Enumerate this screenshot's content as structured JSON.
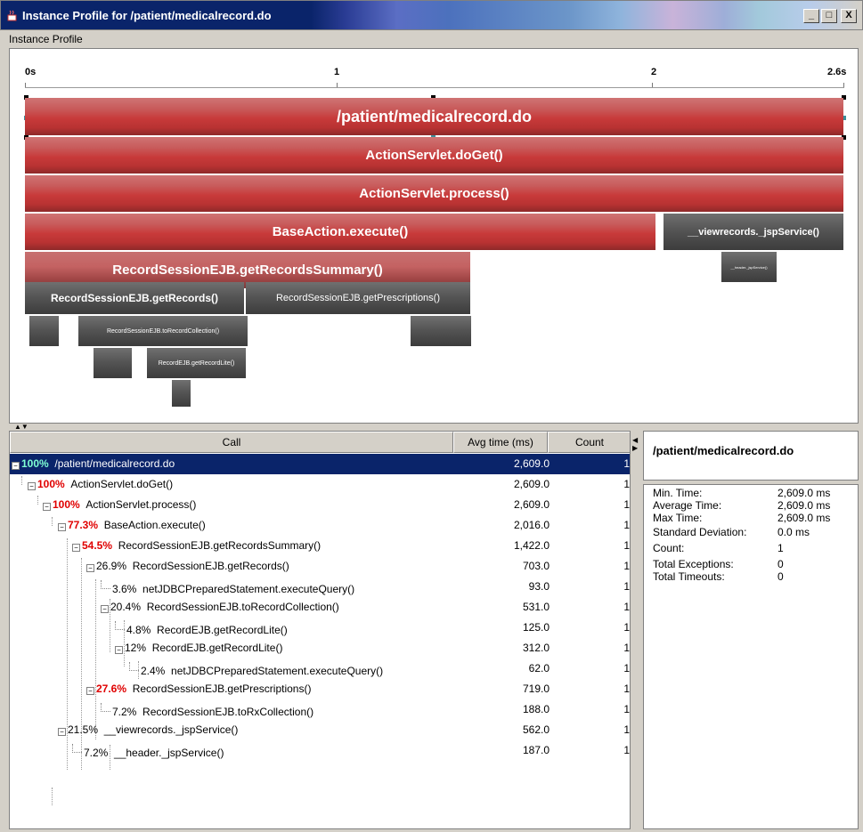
{
  "window": {
    "title": "Instance  Profile for /patient/medicalrecord.do",
    "buttons": [
      "_",
      "□",
      "X"
    ]
  },
  "panel_label": "Instance Profile",
  "timeline": {
    "ticks": [
      "0s",
      "1",
      "2",
      "2.6s"
    ]
  },
  "flame_bars": [
    {
      "label": "/patient/medicalrecord.do"
    },
    {
      "label": "ActionServlet.doGet()"
    },
    {
      "label": "ActionServlet.process()"
    },
    {
      "label": "BaseAction.execute()"
    },
    {
      "label": "__viewrecords._jspService()"
    },
    {
      "label": "__header._jspService()"
    },
    {
      "label": "RecordSessionEJB.getRecordsSummary()"
    },
    {
      "label": "RecordSessionEJB.getRecords()"
    },
    {
      "label": "RecordSessionEJB.getPrescriptions()"
    },
    {
      "label": "RecordSessionEJB.toRecordCollection()"
    },
    {
      "label": "RecordEJB.getRecordLite()"
    }
  ],
  "table": {
    "headers": {
      "call": "Call",
      "avg": "Avg time (ms)",
      "count": "Count"
    },
    "rows": [
      {
        "pct": "100%",
        "name": "/patient/medicalrecord.do",
        "avg": "2,609.0",
        "count": "1"
      },
      {
        "pct": "100%",
        "name": "ActionServlet.doGet()",
        "avg": "2,609.0",
        "count": "1"
      },
      {
        "pct": "100%",
        "name": "ActionServlet.process()",
        "avg": "2,609.0",
        "count": "1"
      },
      {
        "pct": "77.3%",
        "name": "BaseAction.execute()",
        "avg": "2,016.0",
        "count": "1"
      },
      {
        "pct": "54.5%",
        "name": "RecordSessionEJB.getRecordsSummary()",
        "avg": "1,422.0",
        "count": "1"
      },
      {
        "pct": "26.9%",
        "name": "RecordSessionEJB.getRecords()",
        "avg": "703.0",
        "count": "1"
      },
      {
        "pct": "3.6%",
        "name": "netJDBCPreparedStatement.executeQuery()",
        "avg": "93.0",
        "count": "1"
      },
      {
        "pct": "20.4%",
        "name": "RecordSessionEJB.toRecordCollection()",
        "avg": "531.0",
        "count": "1"
      },
      {
        "pct": "4.8%",
        "name": "RecordEJB.getRecordLite()",
        "avg": "125.0",
        "count": "1"
      },
      {
        "pct": "12%",
        "name": "RecordEJB.getRecordLite()",
        "avg": "312.0",
        "count": "1"
      },
      {
        "pct": "2.4%",
        "name": "netJDBCPreparedStatement.executeQuery()",
        "avg": "62.0",
        "count": "1"
      },
      {
        "pct": "27.6%",
        "name": "RecordSessionEJB.getPrescriptions()",
        "avg": "719.0",
        "count": "1"
      },
      {
        "pct": "7.2%",
        "name": "RecordSessionEJB.toRxCollection()",
        "avg": "188.0",
        "count": "1"
      },
      {
        "pct": "21.5%",
        "name": "__viewrecords._jspService()",
        "avg": "562.0",
        "count": "1"
      },
      {
        "pct": "7.2%",
        "name": "__header._jspService()",
        "avg": "187.0",
        "count": "1"
      }
    ]
  },
  "details": {
    "title": "/patient/medicalrecord.do",
    "stats": [
      {
        "key": "Min. Time:",
        "value": "2,609.0 ms"
      },
      {
        "key": "Average Time:",
        "value": "2,609.0 ms"
      },
      {
        "key": "Max Time:",
        "value": "2,609.0 ms"
      },
      {
        "key": "Standard Deviation:",
        "value": "0.0 ms"
      },
      {
        "key": "Count:",
        "value": "1"
      },
      {
        "key": "Total Exceptions:",
        "value": "0"
      },
      {
        "key": "Total Timeouts:",
        "value": "0"
      }
    ]
  }
}
